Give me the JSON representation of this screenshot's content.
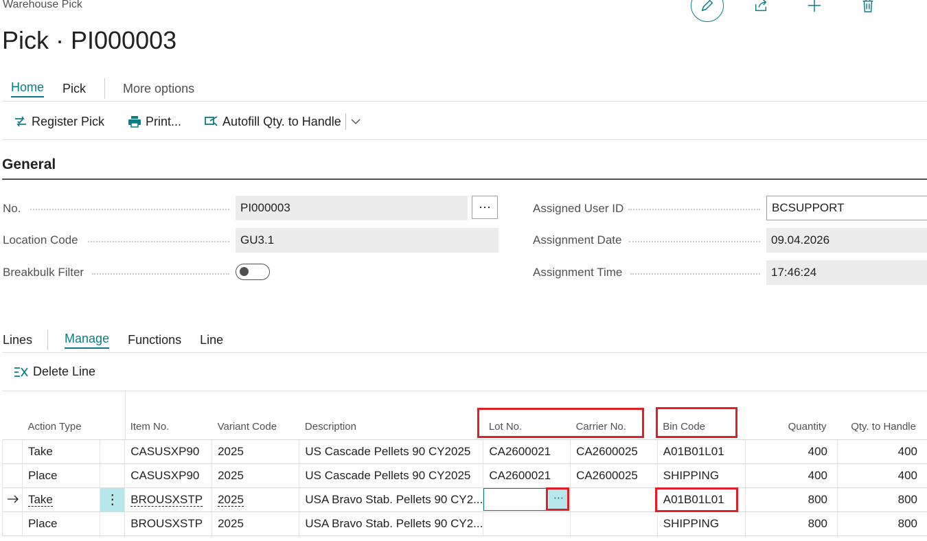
{
  "header": {
    "breadcrumb": "Warehouse Pick",
    "title": "Pick · PI000003"
  },
  "tabs": [
    "Home",
    "Pick"
  ],
  "more_options": "More options",
  "actions": {
    "register_pick": "Register Pick",
    "print": "Print...",
    "autofill": "Autofill Qty. to Handle"
  },
  "general": {
    "section_title": "General",
    "no_label": "No.",
    "no_value": "PI000003",
    "location_label": "Location Code",
    "location_value": "GU3.1",
    "breakbulk_label": "Breakbulk Filter",
    "breakbulk_on": false,
    "user_label": "Assigned User ID",
    "user_value": "BCSUPPORT",
    "date_label": "Assignment Date",
    "date_value": "09.04.2026",
    "time_label": "Assignment Time",
    "time_value": "17:46:24"
  },
  "lines": {
    "title": "Lines",
    "tabs": [
      "Manage",
      "Functions",
      "Line"
    ],
    "delete_line": "Delete Line",
    "columns": [
      "Action Type",
      "Item No.",
      "Variant Code",
      "Description",
      "Lot No.",
      "Carrier No.",
      "Bin Code",
      "Quantity",
      "Qty. to Handle"
    ],
    "rows": [
      [
        "Take",
        "CASUSXP90",
        "2025",
        "US Cascade Pellets 90 CY2025",
        "CA2600021",
        "CA2600025",
        "A01B01L01",
        "400",
        "400"
      ],
      [
        "Place",
        "CASUSXP90",
        "2025",
        "US Cascade Pellets 90 CY2025",
        "CA2600021",
        "CA2600025",
        "SHIPPING",
        "400",
        "400"
      ],
      [
        "Take",
        "BROUSXSTP",
        "2025",
        "USA Bravo Stab. Pellets 90 CY2...",
        "",
        "",
        "A01B01L01",
        "800",
        "800"
      ],
      [
        "Place",
        "BROUSXSTP",
        "2025",
        "USA Bravo Stab. Pellets 90 CY2...",
        "",
        "",
        "SHIPPING",
        "800",
        "800"
      ]
    ]
  },
  "colors": {
    "accent": "#0a7c86",
    "highlight": "#e01e26"
  }
}
